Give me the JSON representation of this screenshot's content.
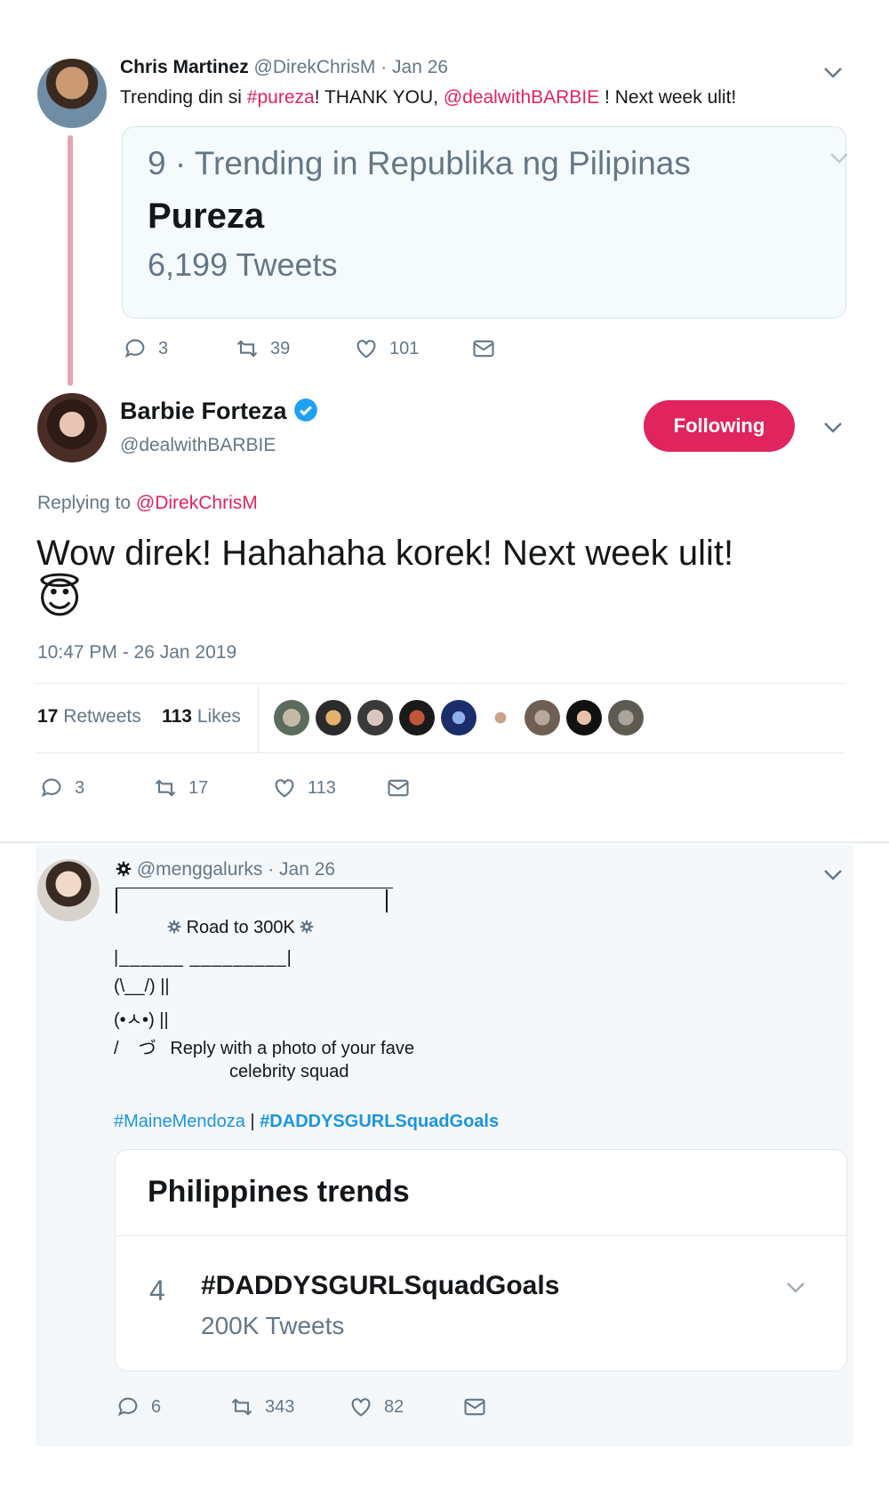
{
  "tweet1": {
    "name": "Chris Martinez",
    "handle": "@DirekChrisM",
    "date": "· Jan 26",
    "text_before": "Trending din si ",
    "hashtag": "#pureza",
    "text_middle": "! THANK YOU, ",
    "mention": "@dealwithBARBIE",
    "text_after": " ! Next week ulit!",
    "card": {
      "rank_line": "9 · Trending in Republika ng Pilipinas",
      "topic": "Pureza",
      "count": "6,199 Tweets"
    },
    "actions": {
      "replies": "3",
      "retweets": "39",
      "likes": "101"
    }
  },
  "tweet2": {
    "name": "Barbie Forteza",
    "handle": "@dealwithBARBIE",
    "follow_label": "Following",
    "replying_prefix": "Replying to ",
    "replying_to": "@DirekChrisM",
    "text": "Wow direk! Hahahaha korek! Next week ulit!",
    "emoji": "😇",
    "timestamp": "10:47 PM - 26 Jan 2019",
    "stats": {
      "retweets_count": "17",
      "retweets_label": "Retweets",
      "likes_count": "113",
      "likes_label": "Likes"
    },
    "actions": {
      "replies": "3",
      "retweets": "17",
      "likes": "113"
    }
  },
  "tweet3": {
    "handle": "@menggalurks",
    "date": "· Jan 26",
    "art_line1": "|‾‾‾‾‾‾‾‾‾‾‾‾‾‾‾‾‾‾‾‾‾‾‾‾‾‾‾‾‾|",
    "art_title": "Road to 300K",
    "art_line3": "|______ _________|",
    "art_line4": "(\\__/) ||",
    "art_line5": "(•ㅅ•) ||",
    "art_line6_prefix": "/    づ",
    "art_line6_text": "Reply with a photo of your fave",
    "art_line7": "celebrity squad",
    "tag1": "#MaineMendoza",
    "separator": " | ",
    "tag2": "#DADDYSGURLSquadGoals",
    "card": {
      "header": "Philippines trends",
      "rank": "4",
      "topic": "#DADDYSGURLSquadGoals",
      "count": "200K Tweets"
    },
    "actions": {
      "replies": "6",
      "retweets": "343",
      "likes": "82"
    }
  },
  "colors": {
    "accent_red": "#e0245e",
    "follow_button": "#e0245e",
    "thread_line": "#e8a3b2",
    "hashtag_blue": "#1b95e0",
    "verified": "#1da1f2"
  }
}
